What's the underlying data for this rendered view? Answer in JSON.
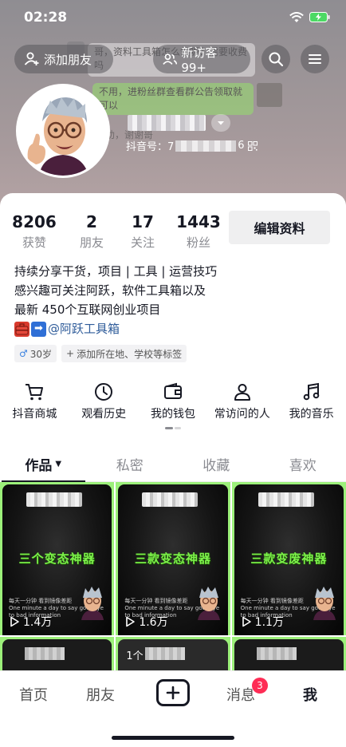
{
  "status_bar": {
    "time": "02:28"
  },
  "background_chat": {
    "msg1": "哥，资料工具箱怎么领呢？需要收费吗",
    "msg2": "不用，进粉丝群查看群公告领取就可以",
    "msg3": "助，谢谢哥"
  },
  "header": {
    "add_friend_label": "添加朋友",
    "new_visitors_label": "新访客 99+",
    "id_prefix": "抖音号：7",
    "id_suffix": "6"
  },
  "stats": {
    "likes": {
      "value": "8206",
      "label": "获赞"
    },
    "friends": {
      "value": "2",
      "label": "朋友"
    },
    "following": {
      "value": "17",
      "label": "关注"
    },
    "fans": {
      "value": "1443",
      "label": "粉丝"
    }
  },
  "edit_profile_label": "编辑资料",
  "bio": {
    "line1": "持续分享干货，项目 | 工具 | 运营技巧",
    "line2": "感兴趣可关注阿跃，软件工具箱以及",
    "line3": "最新 450个互联网创业项目",
    "link": "@阿跃工具箱"
  },
  "tags": {
    "age": "30岁",
    "add_location": "添加所在地、学校等标签"
  },
  "shortcuts": [
    {
      "label": "抖音商城",
      "icon": "cart-icon"
    },
    {
      "label": "观看历史",
      "icon": "clock-icon"
    },
    {
      "label": "我的钱包",
      "icon": "wallet-icon"
    },
    {
      "label": "常访问的人",
      "icon": "person-icon"
    },
    {
      "label": "我的音乐",
      "icon": "music-note-icon"
    }
  ],
  "tabs": [
    "作品",
    "私密",
    "收藏",
    "喜欢"
  ],
  "videos": [
    {
      "title": "三个变态神器",
      "plays": "1.4万"
    },
    {
      "title": "三款变态神器",
      "plays": "1.6万"
    },
    {
      "title": "三款变废神器",
      "plays": "1.1万"
    }
  ],
  "video_caption": {
    "line1": "每天一分钟  看到镜像差距",
    "line2": "One minute a day to say goodbye",
    "line3": "to bad information"
  },
  "row2_label": "1个",
  "bottom_nav": {
    "home": "首页",
    "friends": "朋友",
    "messages": "消息",
    "messages_badge": "3",
    "me": "我"
  },
  "colors": {
    "accent_green": "#9cf07a",
    "badge_red": "#fe2c55",
    "link_blue": "#2f5c9a"
  }
}
